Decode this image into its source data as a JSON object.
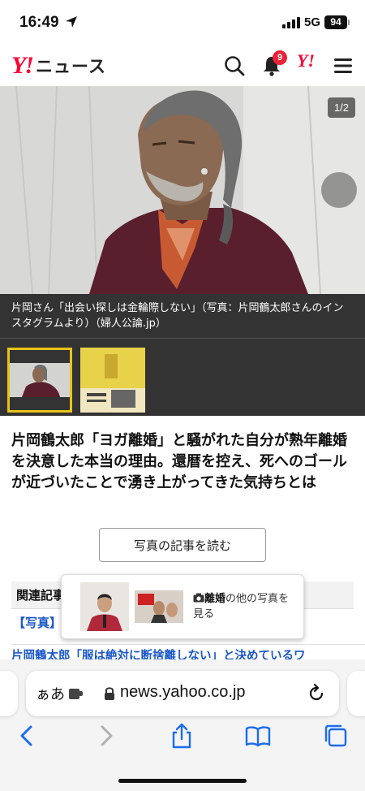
{
  "status": {
    "time": "16:49",
    "network": "5G",
    "battery": "94"
  },
  "header": {
    "logo_mark": "Y!",
    "logo_text": "ニュース",
    "notification_count": "9",
    "yahoo_mark": "Y!"
  },
  "photo": {
    "counter": "1/2",
    "caption": "片岡さん「出会い探しは金輪際しない」（写真：片岡鶴太郎さんのインスタグラムより）（婦人公論.jp）"
  },
  "article": {
    "headline": "片岡鶴太郎「ヨガ離婚」と騒がれた自分が熟年離婚を決意した本当の理由。還暦を控え、死へのゴールが近づいたことで湧き上がってきた気持ちとは",
    "read_button": "写真の記事を読む"
  },
  "related": {
    "heading": "関連記事",
    "tag": "【写真】",
    "link": "片岡鶴太郎「服は絶対に断捨離しない」と決めているワ"
  },
  "popup": {
    "keyword": "離婚",
    "text": "の他の写真を見る"
  },
  "browser": {
    "text_size_label": "ぁあ",
    "url": "news.yahoo.co.jp"
  },
  "icons": [
    "location-arrow-icon",
    "search-icon",
    "bell-icon",
    "menu-icon",
    "chevron-right-icon",
    "camera-icon",
    "extension-icon",
    "lock-icon",
    "reload-icon",
    "back-icon",
    "forward-icon",
    "share-icon",
    "bookmarks-icon",
    "tabs-icon"
  ]
}
